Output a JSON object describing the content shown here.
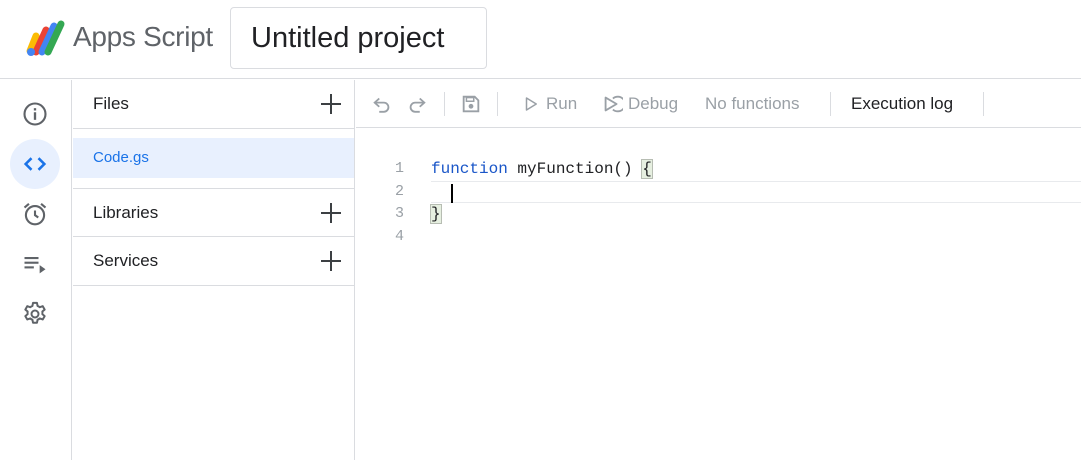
{
  "header": {
    "app_name": "Apps Script",
    "project_title": "Untitled project",
    "logo_icon": "apps-script-logo"
  },
  "rail": {
    "items": [
      {
        "name": "overview",
        "icon": "info-icon",
        "active": false
      },
      {
        "name": "editor",
        "icon": "code-icon",
        "active": true
      },
      {
        "name": "triggers",
        "icon": "alarm-icon",
        "active": false
      },
      {
        "name": "executions",
        "icon": "list-play-icon",
        "active": false
      },
      {
        "name": "settings",
        "icon": "gear-icon",
        "active": false
      }
    ]
  },
  "files_panel": {
    "files_label": "Files",
    "files": [
      "Code.gs"
    ],
    "libraries_label": "Libraries",
    "services_label": "Services"
  },
  "toolbar": {
    "run_label": "Run",
    "debug_label": "Debug",
    "function_select": "No functions",
    "execution_log_label": "Execution log"
  },
  "editor": {
    "line_numbers": [
      "1",
      "2",
      "3",
      "4"
    ],
    "keyword": "function",
    "function_signature": " myFunction() ",
    "open_brace": "{",
    "close_brace": "}"
  },
  "colors": {
    "accent": "#1a73e8",
    "active_bg": "#e8f0fe",
    "border": "#dadce0",
    "disabled_text": "#9aa0a6"
  }
}
